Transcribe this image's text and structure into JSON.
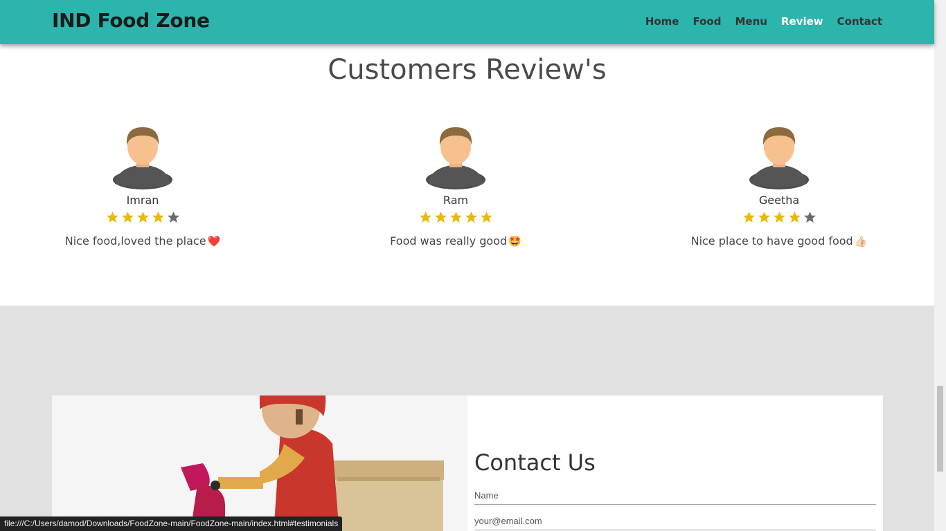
{
  "navbar": {
    "brand": "IND Food Zone",
    "links": [
      "Home",
      "Food",
      "Menu",
      "Review",
      "Contact"
    ],
    "active": "Review",
    "bg_color": "#2bb5ad"
  },
  "reviews": {
    "title": "Customers Review's",
    "items": [
      {
        "name": "Imran",
        "rating": 4,
        "text": "Nice food,loved the place",
        "emoji": "❤️"
      },
      {
        "name": "Ram",
        "rating": 5,
        "text": "Food was really good",
        "emoji": "🤩"
      },
      {
        "name": "Geetha",
        "rating": 4,
        "text": "Nice place to have good food",
        "emoji": "👍🏻"
      }
    ],
    "star_color": "#e8b90b",
    "empty_star_color": "#6b6b6b"
  },
  "contact": {
    "title": "Contact Us",
    "name_placeholder": "Name",
    "email_placeholder": "your@email.com"
  },
  "status_bar": {
    "url": "file:///C:/Users/damod/Downloads/FoodZone-main/FoodZone-main/index.html#testimonials"
  }
}
